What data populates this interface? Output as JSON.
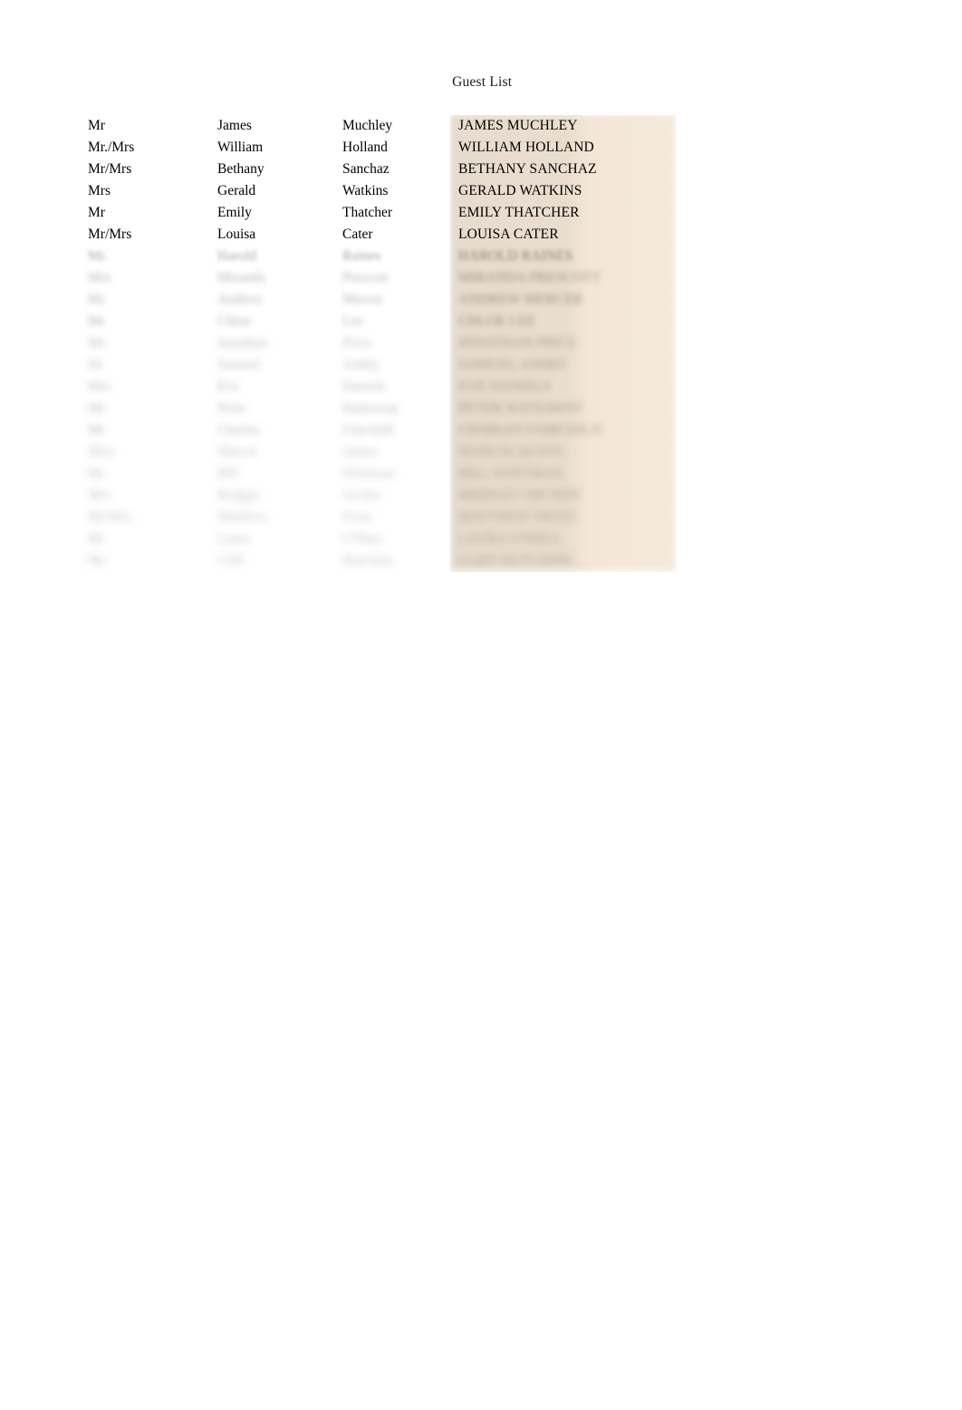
{
  "document": {
    "title": "Guest List",
    "highlight_color": "#ecdfcf",
    "highlight_color_right": "#f5e9db",
    "text_color": "#000000",
    "background_color": "#ffffff"
  },
  "columns": [
    {
      "key": "title",
      "name": "salutation-column"
    },
    {
      "key": "first",
      "name": "first-name-column"
    },
    {
      "key": "last",
      "name": "surname-column"
    },
    {
      "key": "full",
      "name": "full-name-merged-column"
    }
  ],
  "rows": [
    {
      "title": "Mr",
      "first": "James",
      "last": "Muchley",
      "full": "JAMES MUCHLEY",
      "blur": 0
    },
    {
      "title": "Mr./Mrs",
      "first": "William",
      "last": "Holland",
      "full": "WILLIAM HOLLAND",
      "blur": 0
    },
    {
      "title": "Mr/Mrs",
      "first": "Bethany",
      "last": "Sanchaz",
      "full": "BETHANY SANCHAZ",
      "blur": 0
    },
    {
      "title": "Mrs",
      "first": "Gerald",
      "last": "Watkins",
      "full": "GERALD WATKINS",
      "blur": 0
    },
    {
      "title": "Mr",
      "first": "Emily",
      "last": "Thatcher",
      "full": "EMILY THATCHER",
      "blur": 0
    },
    {
      "title": "Mr/Mrs",
      "first": "Louisa",
      "last": "Cater",
      "full": "LOUISA CATER",
      "blur": 0
    },
    {
      "title": "Mr.",
      "first": "Harold",
      "last": "Raines",
      "full": "HAROLD RAINES",
      "blur": 1
    },
    {
      "title": "Mrs",
      "first": "Miranda",
      "last": "Prescott",
      "full": "MIRANDA PRESCOTT",
      "blur": 2
    },
    {
      "title": "Mr",
      "first": "Andrew",
      "last": "Mercer",
      "full": "ANDREW MERCER",
      "blur": 2
    },
    {
      "title": "Mr",
      "first": "Chloe",
      "last": "Lee",
      "full": "CHLOE LEE",
      "blur": 2
    },
    {
      "title": "Ms",
      "first": "Jonathan",
      "last": "Price",
      "full": "JONATHAN PRICE",
      "blur": 3
    },
    {
      "title": "Dr",
      "first": "Samuel",
      "last": "Ashby",
      "full": "SAMUEL ASHBY",
      "blur": 3
    },
    {
      "title": "Mrs",
      "first": "Eve",
      "last": "Daniels",
      "full": "EVE DANIELS",
      "blur": 3
    },
    {
      "title": "Mr",
      "first": "Peter",
      "last": "Hathaway",
      "full": "PETER HATHAWAY",
      "blur": 3
    },
    {
      "title": "Mr",
      "first": "Charles",
      "last": "Fairchild",
      "full": "CHARLES FAIRCHILD",
      "blur": 3
    },
    {
      "title": "Miss",
      "first": "Marcie",
      "last": "Quinn",
      "full": "MARCIE QUINN",
      "blur": 4
    },
    {
      "title": "Mr",
      "first": "Bill",
      "last": "Whitman",
      "full": "BILL WHITMAN",
      "blur": 4
    },
    {
      "title": "Mrs",
      "first": "Bridget",
      "last": "Archer",
      "full": "BRIDGET ARCHER",
      "blur": 4
    },
    {
      "title": "Mr/Mrs",
      "first": "Matthew",
      "last": "Frost",
      "full": "MATTHEW FROST",
      "blur": 4
    },
    {
      "title": "Mr",
      "first": "Laura",
      "last": "O'Shea",
      "full": "LAURA O'SHEA",
      "blur": 4
    },
    {
      "title": "Mr",
      "first": "Cliff",
      "last": "Hutchins",
      "full": "CLIFF HUTCHINS",
      "blur": 4
    }
  ]
}
